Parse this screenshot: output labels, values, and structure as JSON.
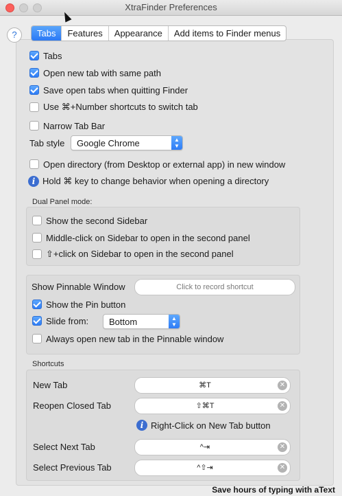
{
  "window": {
    "title": "XtraFinder Preferences"
  },
  "tabs": [
    "Tabs",
    "Features",
    "Appearance",
    "Add items to Finder menus"
  ],
  "help_label": "?",
  "general": {
    "tabs_label": "Tabs",
    "same_path_label": "Open new tab with same path",
    "save_tabs_label": "Save open tabs when quitting Finder",
    "number_shortcuts_label": "Use ⌘+Number shortcuts to switch tab",
    "narrow_label": "Narrow Tab Bar",
    "tab_style_label": "Tab style",
    "tab_style_value": "Google Chrome",
    "open_directory_label": "Open directory (from Desktop or external app) in new window",
    "hold_info": "Hold ⌘ key to change behavior when opening a directory"
  },
  "dual_panel": {
    "heading": "Dual Panel mode:",
    "show_sidebar_label": "Show the second Sidebar",
    "middle_click_label": "Middle-click on Sidebar to open in the second panel",
    "shift_click_label": "⇧+click on Sidebar to open in the second panel"
  },
  "pinnable": {
    "label": "Show Pinnable Window",
    "record_placeholder": "Click to record shortcut",
    "show_pin_label": "Show the Pin button",
    "slide_from_label": "Slide from:",
    "slide_from_value": "Bottom",
    "always_open_label": "Always open new tab in the Pinnable window"
  },
  "shortcuts": {
    "heading": "Shortcuts",
    "new_tab_label": "New Tab",
    "new_tab_value": "⌘T",
    "reopen_label": "Reopen Closed Tab",
    "reopen_value": "⇧⌘T",
    "right_click_info": "Right-Click on New Tab button",
    "next_label": "Select Next Tab",
    "next_value": "^⇥",
    "prev_label": "Select Previous Tab",
    "prev_value": "^⇧⇥"
  },
  "footer": "Save hours of typing with aText",
  "colors": {
    "accent": "#2e7cf6",
    "close": "#fc605c"
  },
  "checkbox_states": {
    "tabs": true,
    "same_path": true,
    "save_tabs": true,
    "number_shortcuts": false,
    "narrow": false,
    "open_directory": false,
    "show_sidebar": false,
    "middle_click": false,
    "shift_click": false,
    "show_pin": true,
    "slide_from": true,
    "always_open": false
  }
}
